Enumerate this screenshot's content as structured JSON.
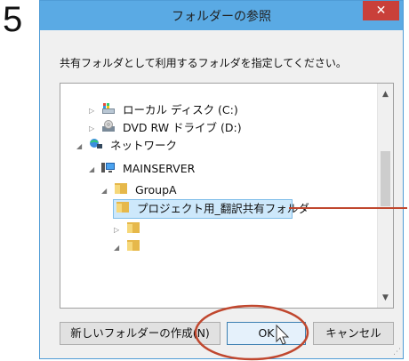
{
  "step": "5",
  "dialog": {
    "title": "フォルダーの参照",
    "close_glyph": "✕",
    "instruction": "共有フォルダとして利用するフォルダを指定してください。",
    "tree": [
      {
        "label": "ローカル ディスク (C:)",
        "icon": "local-disk-icon",
        "expander": "▷"
      },
      {
        "label": "DVD RW ドライブ (D:)",
        "icon": "dvd-drive-icon",
        "expander": "▷"
      },
      {
        "label": "ネットワーク",
        "icon": "network-icon",
        "expander": "◢"
      },
      {
        "label": "MAINSERVER",
        "icon": "server-icon",
        "expander": "◢"
      },
      {
        "label": "GroupA",
        "icon": "folder-icon",
        "expander": "◢"
      },
      {
        "label": "プロジェクト用_翻訳共有フォルダ",
        "icon": "folder-icon",
        "expander": "",
        "selected": true
      },
      {
        "label": "",
        "icon": "folder-icon",
        "expander": "▷"
      },
      {
        "label": "",
        "icon": "folder-icon",
        "expander": "◢"
      }
    ],
    "scroll_up_glyph": "▲",
    "scroll_down_glyph": "▼",
    "buttons": {
      "new_folder": "新しいフォルダーの作成(N)",
      "ok": "OK",
      "cancel": "キャンセル"
    }
  },
  "colors": {
    "titlebar": "#5aaae4",
    "close": "#c9403a",
    "annotation": "#c0472e"
  }
}
